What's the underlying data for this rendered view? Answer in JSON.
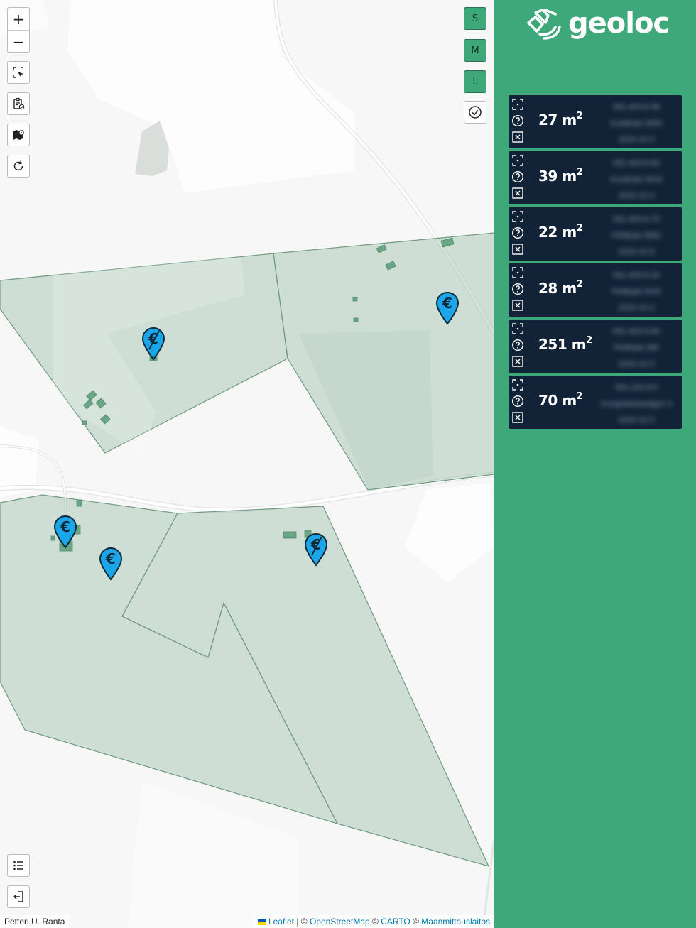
{
  "map": {
    "zoom_in_label": "+",
    "zoom_out_label": "−",
    "size_buttons": [
      "S",
      "M",
      "L"
    ],
    "attribution_left": "Petteri U. Ranta",
    "attribution": {
      "leaflet": "Leaflet",
      "separator": " | © ",
      "osm": "OpenStreetMap",
      "copy1": " © ",
      "carto": "CARTO",
      "copy2": " © ",
      "mml": "Maanmittauslaitos"
    },
    "markers": [
      {
        "type": "euro-crossed"
      },
      {
        "type": "euro"
      },
      {
        "type": "euro"
      },
      {
        "type": "euro"
      },
      {
        "type": "euro-crossed"
      }
    ],
    "colors": {
      "marker": "#1aa6e8",
      "parcel": "#8db59e",
      "parcel_stroke": "#6f9a80"
    }
  },
  "sidebar": {
    "logo_text": "geoloc",
    "accent": "#3fa87a",
    "card_bg": "#122338",
    "cards": [
      {
        "area": "27",
        "unit": "m",
        "sup": "2",
        "line1": "091-403-6-58",
        "line2": "Kuokkala 3082",
        "line3": "2020-10-3"
      },
      {
        "area": "39",
        "unit": "m",
        "sup": "2",
        "line1": "091-403-6-60",
        "line2": "Kuokkala 3019",
        "line3": "2020-10-3"
      },
      {
        "area": "22",
        "unit": "m",
        "sup": "2",
        "line1": "091-405-6-70",
        "line2": "Pirttikylä 4082",
        "line3": "2020-10-5"
      },
      {
        "area": "28",
        "unit": "m",
        "sup": "2",
        "line1": "091-405-6-34",
        "line2": "Pirttikylä 5043",
        "line3": "2020-10-3"
      },
      {
        "area": "251",
        "unit": "m",
        "sup": "2",
        "line1": "091-403-6-60",
        "line2": "Pirttikylä 390",
        "line3": "2020-10-3"
      },
      {
        "area": "70",
        "unit": "m",
        "sup": "2",
        "line1": "091-103-6-5",
        "line2": "Kungsbackavägen 4",
        "line3": "2020-10-3"
      }
    ]
  }
}
